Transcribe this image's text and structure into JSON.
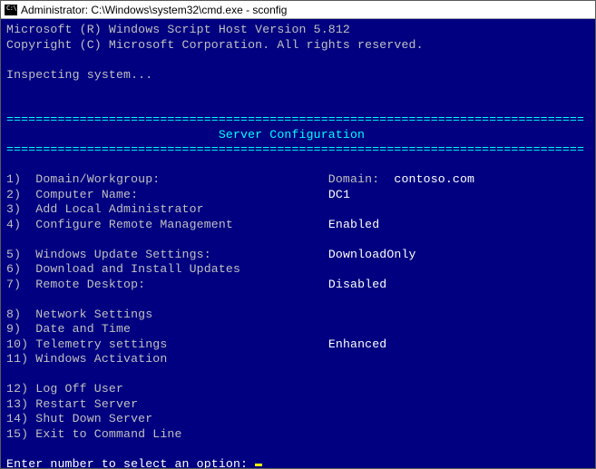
{
  "titlebar": {
    "text": "Administrator: C:\\Windows\\system32\\cmd.exe - sconfig"
  },
  "header": {
    "line1": "Microsoft (R) Windows Script Host Version 5.812",
    "line2": "Copyright (C) Microsoft Corporation. All rights reserved.",
    "inspecting": "Inspecting system..."
  },
  "rule": "===============================================================================",
  "banner_title": "                             Server Configuration",
  "menu": {
    "items": [
      {
        "num": "1)",
        "label": "Domain/Workgroup:",
        "value_prefix": "Domain:  ",
        "value": "contoso.com"
      },
      {
        "num": "2)",
        "label": "Computer Name:",
        "value_prefix": "",
        "value": "DC1"
      },
      {
        "num": "3)",
        "label": "Add Local Administrator",
        "value_prefix": "",
        "value": ""
      },
      {
        "num": "4)",
        "label": "Configure Remote Management",
        "value_prefix": "",
        "value": "Enabled"
      },
      {
        "num": "",
        "label": "",
        "value_prefix": "",
        "value": ""
      },
      {
        "num": "5)",
        "label": "Windows Update Settings:",
        "value_prefix": "",
        "value": "DownloadOnly"
      },
      {
        "num": "6)",
        "label": "Download and Install Updates",
        "value_prefix": "",
        "value": ""
      },
      {
        "num": "7)",
        "label": "Remote Desktop:",
        "value_prefix": "",
        "value": "Disabled"
      },
      {
        "num": "",
        "label": "",
        "value_prefix": "",
        "value": ""
      },
      {
        "num": "8)",
        "label": "Network Settings",
        "value_prefix": "",
        "value": ""
      },
      {
        "num": "9)",
        "label": "Date and Time",
        "value_prefix": "",
        "value": ""
      },
      {
        "num": "10)",
        "label": "Telemetry settings",
        "value_prefix": "",
        "value": "Enhanced"
      },
      {
        "num": "11)",
        "label": "Windows Activation",
        "value_prefix": "",
        "value": ""
      },
      {
        "num": "",
        "label": "",
        "value_prefix": "",
        "value": ""
      },
      {
        "num": "12)",
        "label": "Log Off User",
        "value_prefix": "",
        "value": ""
      },
      {
        "num": "13)",
        "label": "Restart Server",
        "value_prefix": "",
        "value": ""
      },
      {
        "num": "14)",
        "label": "Shut Down Server",
        "value_prefix": "",
        "value": ""
      },
      {
        "num": "15)",
        "label": "Exit to Command Line",
        "value_prefix": "",
        "value": ""
      }
    ]
  },
  "prompt": "Enter number to select an option: "
}
